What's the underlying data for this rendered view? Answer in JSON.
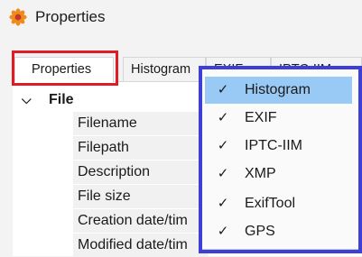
{
  "window": {
    "title": "Properties"
  },
  "tabs": [
    "Properties",
    "Histogram",
    "EXIF",
    "IPTC-IIM"
  ],
  "active_tab": "Properties",
  "tree": {
    "group": "File",
    "rows": [
      "Filename",
      "Filepath",
      "Description",
      "File size",
      "Creation date/tim",
      "Modified date/tim"
    ]
  },
  "menu": {
    "items": [
      {
        "label": "Histogram",
        "checked": true,
        "highlighted": true
      },
      {
        "label": "EXIF",
        "checked": true
      },
      {
        "label": "IPTC-IIM",
        "checked": true
      },
      {
        "label": "XMP",
        "checked": true
      },
      {
        "label": "ExifTool",
        "checked": true
      },
      {
        "label": "GPS",
        "checked": true
      }
    ]
  },
  "colors": {
    "tab_highlight": "#e01b24",
    "menu_highlight": "#3d3fd6",
    "menu_hover": "#99c9f5"
  },
  "icons": {
    "app": "sunflower-icon",
    "check": "check-icon",
    "collapse": "chevron-down-icon"
  }
}
